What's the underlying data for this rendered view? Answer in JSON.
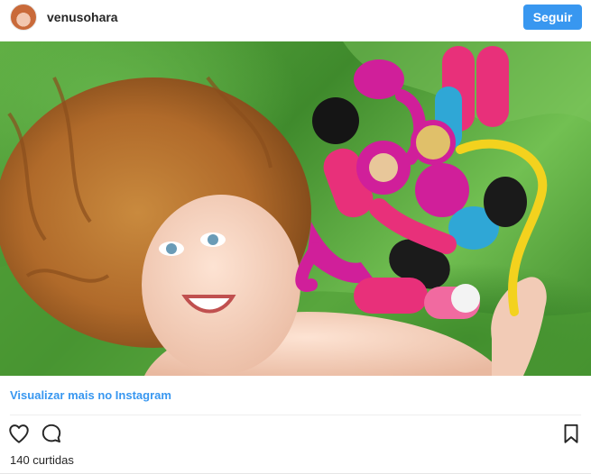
{
  "post": {
    "username": "venusohara",
    "follow_label": "Seguir",
    "view_more_label": "Visualizar mais no Instagram",
    "likes_text": "140 curtidas"
  },
  "icons": {
    "like": "heart-icon",
    "comment": "comment-icon",
    "save": "bookmark-icon"
  },
  "colors": {
    "accent": "#3897f0",
    "background": "#ffffff",
    "text": "#262626",
    "sheet_green": "#5fae43",
    "toy_pink": "#e8307a",
    "toy_magenta": "#d01f9a",
    "toy_yellow": "#f3d21e",
    "toy_blue": "#2fa7d6"
  }
}
